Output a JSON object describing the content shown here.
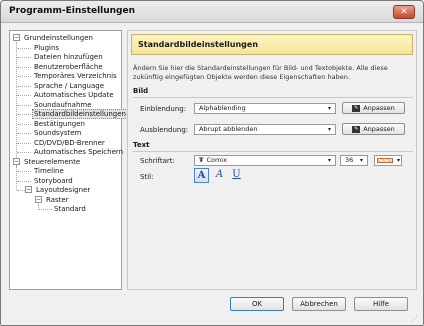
{
  "window": {
    "title": "Programm-Einstellungen",
    "close_glyph": "✕"
  },
  "tree": {
    "root1": "Grundeinstellungen",
    "root1_children": [
      "Plugins",
      "Dateien hinzufügen",
      "Benutzeroberfläche",
      "Temporäres Verzeichnis",
      "Sprache / Language",
      "Automatisches Update",
      "Soundaufnahme",
      "Standardbildeinstellungen",
      "Bestätigungen",
      "Soundsystem",
      "CD/DVD/BD-Brenner",
      "Automatisches Speichern"
    ],
    "root2": "Steuerelemente",
    "root2_children": [
      "Timeline",
      "Storyboard",
      "Layoutdesigner"
    ],
    "raster": "Raster",
    "standard": "Standard",
    "expander_minus": "−",
    "selected": "Standardbildeinstellungen"
  },
  "content": {
    "header_title": "Standardbildeinstellungen",
    "description": "Ändern Sie hier die Standardeinstellungen für Bild- und Textobjekte. Alle diese zukünftig eingefügten Objekte werden diese Eigenschaften haben.",
    "section_bild": "Bild",
    "einblendung_label": "Einblendung:",
    "einblendung_value": "Alphablending",
    "ausblendung_label": "Ausblendung:",
    "ausblendung_value": "Abrupt abblenden",
    "anpassen_label": "Anpassen",
    "section_text": "Text",
    "schriftart_label": "Schriftart:",
    "font_icon_glyph": "Ŧ",
    "schriftart_value": "Comix",
    "size_value": "36",
    "stil_label": "Stil:",
    "bold_glyph": "A",
    "italic_glyph": "A",
    "underline_glyph": "U",
    "dropdown_glyph": "▾",
    "colors": {
      "header_bg": "#f8e59a",
      "accent": "#1e4f9a",
      "swatch": "#f4c4a0"
    }
  },
  "buttons": {
    "ok": "OK",
    "cancel": "Abbrechen",
    "help": "Hilfe"
  }
}
